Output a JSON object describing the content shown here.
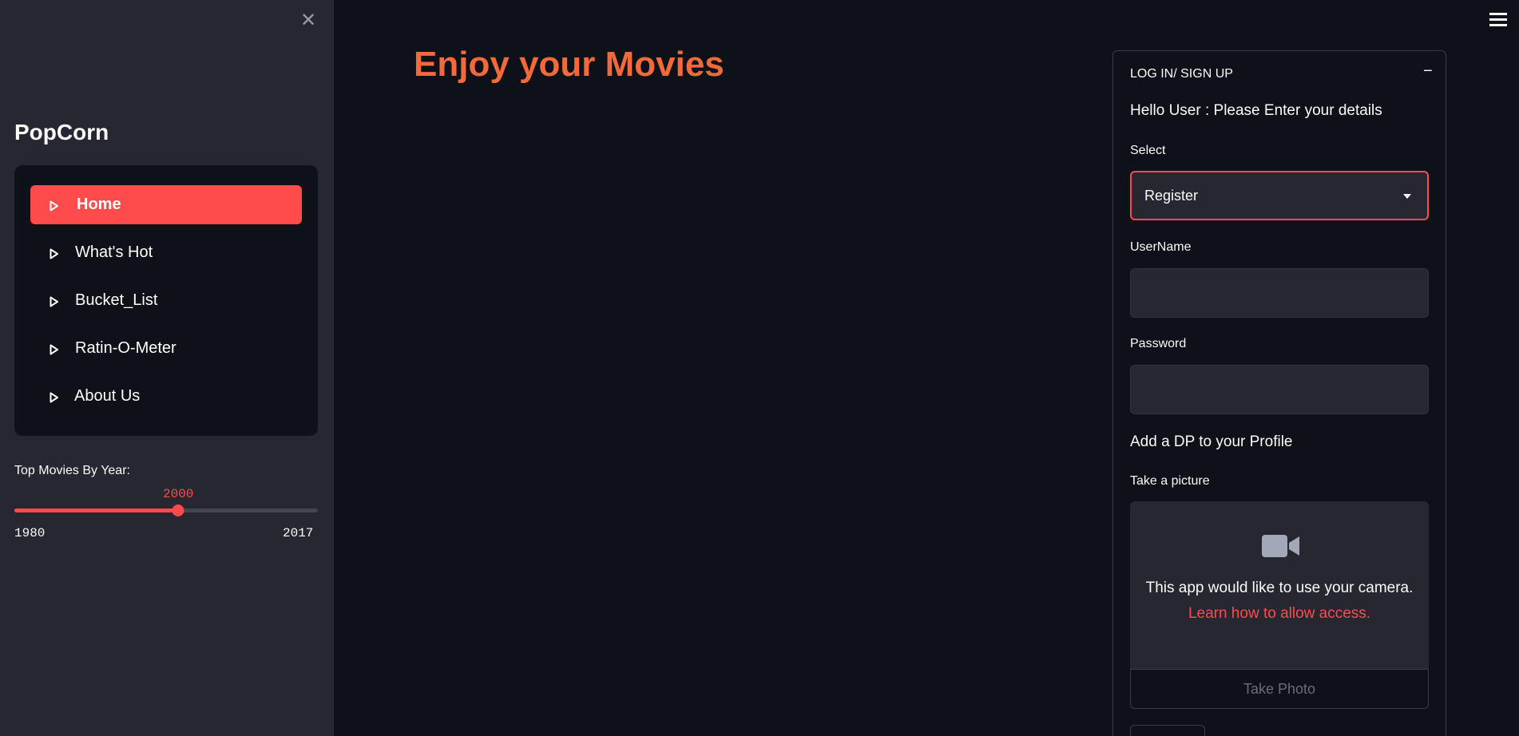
{
  "sidebar": {
    "close_icon": "close-icon",
    "title": "PopCorn",
    "nav": [
      {
        "label": "Home",
        "active": true
      },
      {
        "label": "What's Hot",
        "active": false
      },
      {
        "label": "Bucket_List",
        "active": false
      },
      {
        "label": "Ratin-O-Meter",
        "active": false
      },
      {
        "label": "About Us",
        "active": false
      }
    ],
    "slider": {
      "label": "Top Movies By Year:",
      "value": "2000",
      "min": "1980",
      "max": "2017",
      "fraction": 0.54
    }
  },
  "main": {
    "title": "Enjoy your Movies",
    "menu_icon": "hamburger-menu-icon"
  },
  "panel": {
    "header": "LOG IN/ SIGN UP",
    "collapse_symbol": "−",
    "greeting": "Hello User : Please Enter your details",
    "select_label": "Select",
    "select_value": "Register",
    "username_label": "UserName",
    "password_label": "Password",
    "dp_text": "Add a DP to your Profile",
    "camera_label": "Take a picture",
    "camera_message": "This app would like to use your camera.",
    "camera_link": "Learn how to allow access.",
    "take_photo_label": "Take Photo"
  },
  "colors": {
    "accent": "#ff4b4b",
    "title": "#f26a3c",
    "background": "#0e1117",
    "sidebar": "#262730"
  }
}
